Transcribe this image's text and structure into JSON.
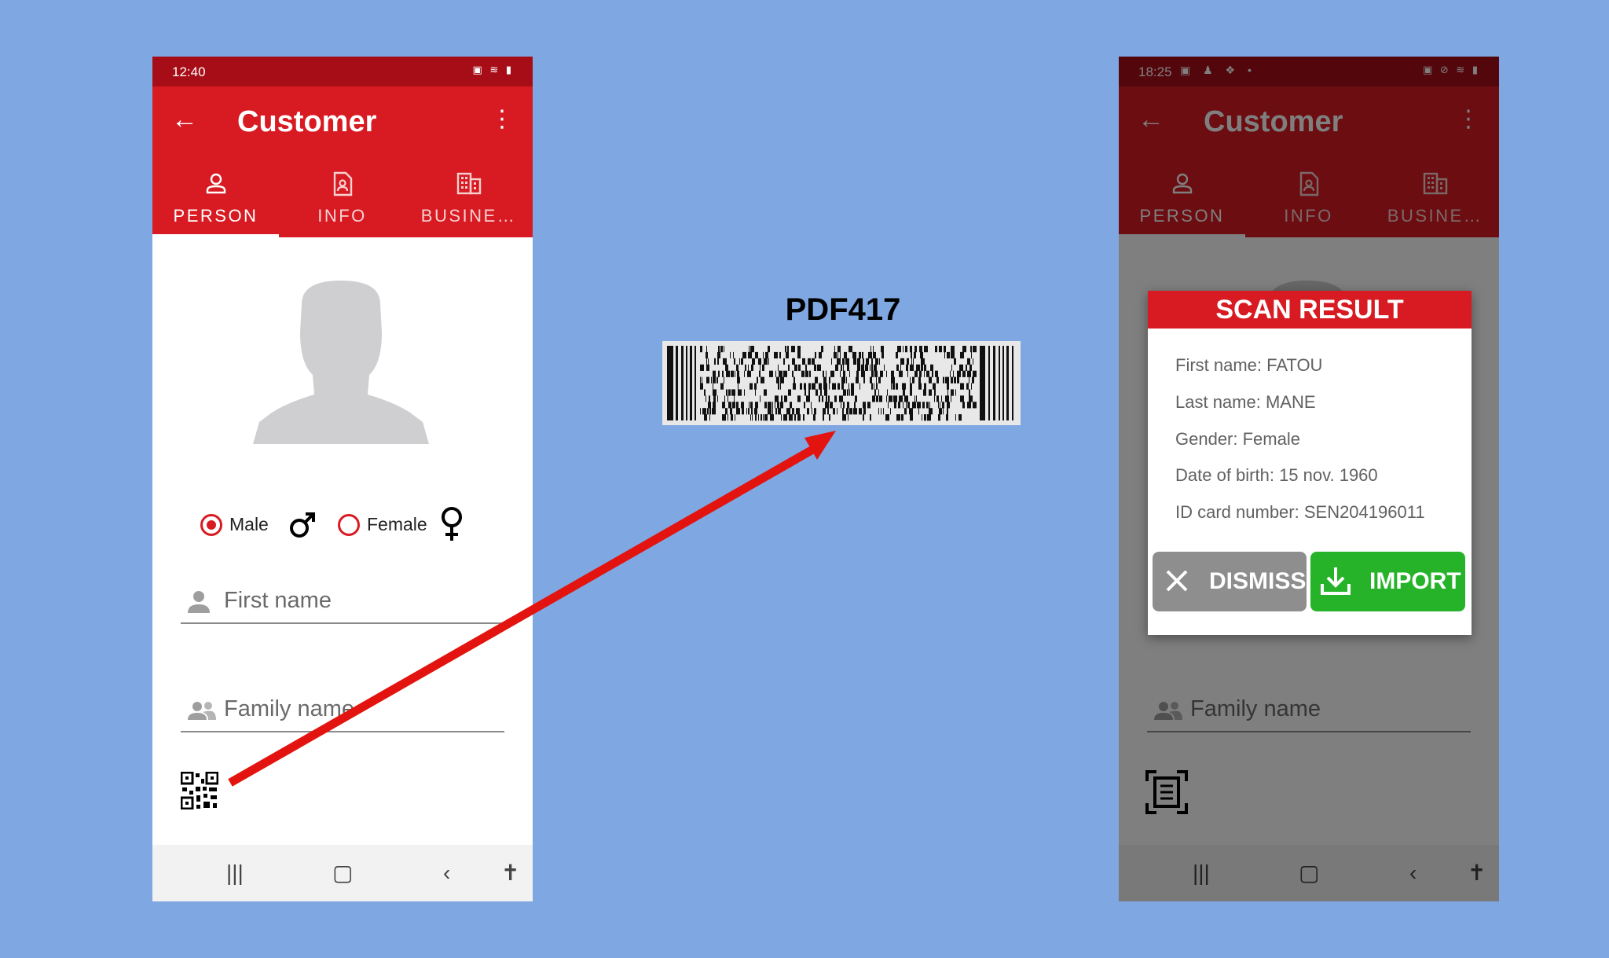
{
  "colors": {
    "background": "#7fa7e1",
    "app_primary": "#d81b22",
    "status_bar": "#a70d17",
    "import_button": "#26b32a",
    "dismiss_button": "#8e8e8e",
    "arrow": "#e3140f"
  },
  "left_phone": {
    "status_time": "12:40",
    "title": "Customer",
    "tabs": [
      {
        "label": "PERSON",
        "icon": "person-icon",
        "active": true
      },
      {
        "label": "INFO",
        "icon": "contact-card-icon",
        "active": false
      },
      {
        "label": "BUSINE…",
        "icon": "building-icon",
        "active": false
      }
    ],
    "gender": {
      "male_label": "Male",
      "female_label": "Female",
      "selected": "male"
    },
    "first_name_placeholder": "First name",
    "family_name_placeholder": "Family name",
    "scan_icon": "qr-code-icon"
  },
  "barcode": {
    "title": "PDF417"
  },
  "right_phone": {
    "status_time": "18:25",
    "title": "Customer",
    "tabs": [
      {
        "label": "PERSON",
        "icon": "person-icon",
        "active": true
      },
      {
        "label": "INFO",
        "icon": "contact-card-icon",
        "active": false
      },
      {
        "label": "BUSINE…",
        "icon": "building-icon",
        "active": false
      }
    ],
    "family_name_placeholder": "Family name",
    "scan_icon": "document-scan-icon",
    "dialog": {
      "title": "SCAN RESULT",
      "lines": [
        "First name: FATOU",
        "Last name: MANE",
        "Gender: Female",
        "Date of birth: 15 nov. 1960",
        "ID card number: SEN204196011"
      ],
      "dismiss_label": "DISMISS",
      "import_label": "IMPORT"
    }
  }
}
